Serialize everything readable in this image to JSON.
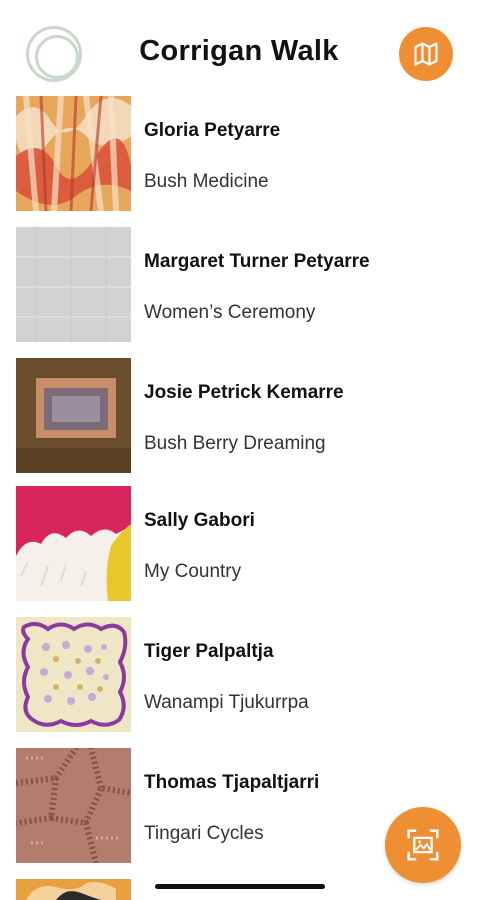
{
  "header": {
    "title": "Corrigan Walk",
    "accent": "#ef8f34",
    "left_icon": "ring-icon",
    "right_icon": "map-icon"
  },
  "artworks": [
    {
      "artist": "Gloria Petyarre",
      "title": "Bush Medicine"
    },
    {
      "artist": "Margaret Turner Petyarre",
      "title": "Women’s Ceremony"
    },
    {
      "artist": "Josie Petrick Kemarre",
      "title": "Bush Berry Dreaming"
    },
    {
      "artist": "Sally Gabori",
      "title": "My Country"
    },
    {
      "artist": "Tiger Palpaltja",
      "title": "Wanampi Tjukurrpa"
    },
    {
      "artist": "Thomas Tjapaltjarri",
      "title": "Tingari Cycles"
    }
  ],
  "fab": {
    "icon": "image-scan-icon"
  }
}
